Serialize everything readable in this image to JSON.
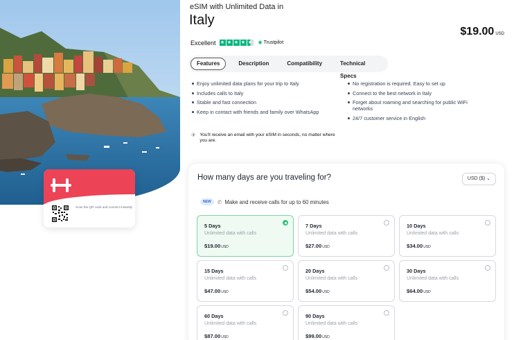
{
  "product": {
    "subtitle": "eSIM with Unlimited Data in",
    "country": "Italy",
    "price": "$19.00",
    "price_currency": "USD"
  },
  "rating": {
    "label": "Excellent",
    "stars": 4.5,
    "provider": "Trustpilot",
    "color": "#00b67a"
  },
  "tabs": [
    {
      "label": "Features",
      "active": true
    },
    {
      "label": "Description",
      "active": false
    },
    {
      "label": "Compatibility",
      "active": false
    },
    {
      "label": "Technical Specs",
      "active": false
    }
  ],
  "features_left": [
    "Enjoy unlimited data plans for your trip to Italy",
    "Includes calls to Italy",
    "Stable and fast connection",
    "Keep in contact with friends and family over WhatsApp"
  ],
  "features_right": [
    "No registration is required. Easy to set up",
    "Connect to the best network in Italy",
    "Forget about roaming and searching for public WiFi networks",
    "24/7 customer service in English"
  ],
  "email_note": "You'll receive an email with your eSIM in seconds, no matter where you are.",
  "card": {
    "qr_text": "Scan the QR code and connect instantly",
    "brand_color": "#ec4356"
  },
  "days": {
    "title": "How many days are you traveling for?",
    "currency_select": "USD ($)",
    "new_badge": "NEW",
    "calls_note": "Make and receive calls for up to 60 minutes",
    "plans": [
      {
        "name": "5 Days",
        "desc": "Unlimited data with calls",
        "price": "$19.00",
        "currency": "USD",
        "selected": true
      },
      {
        "name": "7 Days",
        "desc": "Unlimited data with calls",
        "price": "$27.00",
        "currency": "USD",
        "selected": false
      },
      {
        "name": "10 Days",
        "desc": "Unlimited data with calls",
        "price": "$34.00",
        "currency": "USD",
        "selected": false
      },
      {
        "name": "15 Days",
        "desc": "Unlimited data with calls",
        "price": "$47.00",
        "currency": "USD",
        "selected": false
      },
      {
        "name": "20 Days",
        "desc": "Unlimited data with calls",
        "price": "$54.00",
        "currency": "USD",
        "selected": false
      },
      {
        "name": "30 Days",
        "desc": "Unlimited data with calls",
        "price": "$64.00",
        "currency": "USD",
        "selected": false
      },
      {
        "name": "60 Days",
        "desc": "Unlimited data with calls",
        "price": "$87.00",
        "currency": "USD",
        "selected": false
      },
      {
        "name": "90 Days",
        "desc": "Unlimited data with calls",
        "price": "$99.00",
        "currency": "USD",
        "selected": false
      }
    ]
  }
}
